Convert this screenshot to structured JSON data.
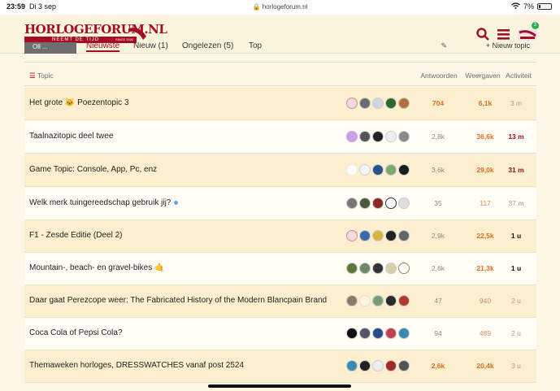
{
  "status": {
    "time": "23:59",
    "date": "Di 3 sep",
    "url": "horlogeforum.nl",
    "battery": "7%"
  },
  "header": {
    "logo_text": "HORLOGEFORUM.NL",
    "logo_tagline": "NEEMT DE TIJD",
    "logo_since": "SINCE 2002",
    "notif_count": "3"
  },
  "nav": {
    "category": "Oll ...",
    "tabs": [
      "Nieuwste",
      "Nieuw (1)",
      "Ongelezen (5)",
      "Top"
    ],
    "new_topic": "+ Nieuw topic"
  },
  "columns": {
    "topic": "Topic",
    "answers": "Antwoorden",
    "views": "Weergaven",
    "activity": "Activiteit"
  },
  "colors": {
    "accent": "#a50d24",
    "hot": "#e86c1e",
    "row_shade": "#fbefcf"
  },
  "topics": [
    {
      "title": "Het grote 🐱 Poezentopic 3",
      "answers": "704",
      "views": "6,1k",
      "activity": "3 m"
    },
    {
      "title": "Taalnazitopic deel twee",
      "answers": "2,8k",
      "views": "36,6k",
      "activity": "13 m"
    },
    {
      "title": "Game Topic: Console, App, Pc, enz",
      "answers": "3,6k",
      "views": "29,0k",
      "activity": "31 m"
    },
    {
      "title": "Welk merk tuingereedschap gebruik jij?",
      "answers": "35",
      "views": "117",
      "activity": "37 m"
    },
    {
      "title": "F1 - Zesde Editie (Deel 2)",
      "answers": "2,9k",
      "views": "22,5k",
      "activity": "1 u"
    },
    {
      "title": "Mountain-, beach- en gravel-bikes 🤙",
      "answers": "2,6k",
      "views": "21,3k",
      "activity": "1 u"
    },
    {
      "title": "Daar gaat Perezcope weer: The Fabricated History of the Modern Blancpain Brand",
      "answers": "47",
      "views": "940",
      "activity": "2 u"
    },
    {
      "title": "Coca Cola of Pepsi Cola?",
      "answers": "94",
      "views": "489",
      "activity": "2 u"
    },
    {
      "title": "Themaweken horloges, DRESSWATCHES vanaf post 2524",
      "answers": "2,6k",
      "views": "20,4k",
      "activity": "3 u"
    }
  ]
}
